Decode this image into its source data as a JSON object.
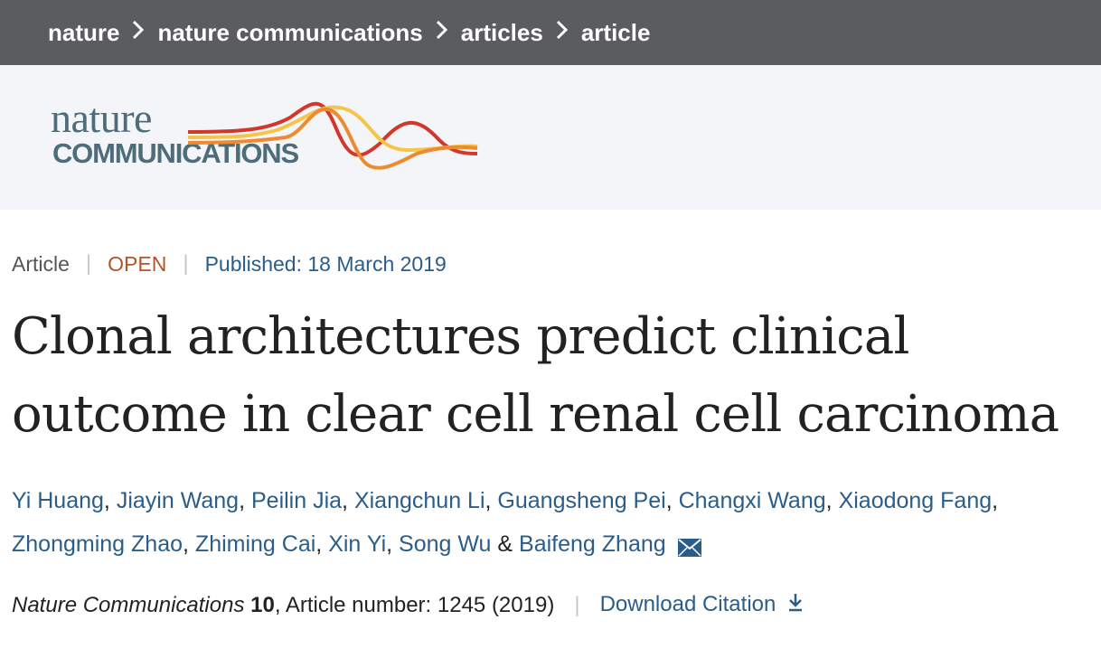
{
  "breadcrumb": {
    "items": [
      "nature",
      "nature communications",
      "articles",
      "article"
    ],
    "separator": ">"
  },
  "logo": {
    "word_top": "nature",
    "word_bottom": "COMMUNICATIONS",
    "colors": {
      "text": "#4e6d7a",
      "wave_red": "#d2372b",
      "wave_orange": "#ee8a2f",
      "wave_yellow": "#f5c54a"
    }
  },
  "meta": {
    "type": "Article",
    "access": "OPEN",
    "published": "Published: 18 March 2019"
  },
  "title": {
    "line1": "Clonal architectures predict clinical",
    "line2": "outcome in clear cell renal cell carcinoma"
  },
  "authors": {
    "list": [
      "Yi Huang",
      "Jiayin Wang",
      "Peilin Jia",
      "Xiangchun Li",
      "Guangsheng Pei",
      "Changxi Wang",
      "Xiaodong Fang",
      "Zhongming Zhao",
      "Zhiming Cai",
      "Xin Yi",
      "Song Wu",
      "Baifeng Zhang"
    ],
    "comma": ",",
    "conjunction": "&",
    "contact_icon": "envelope-icon"
  },
  "citation": {
    "journal": "Nature Communications",
    "volume": "10",
    "details": ", Article number: 1245 (2019)",
    "download_label": "Download Citation",
    "download_icon": "download-arrow-icon"
  },
  "colors": {
    "breadcrumb_bg": "#5b5c60",
    "logo_band_bg": "#f3f5f8",
    "link_blue": "#2a5d8a",
    "open_orange": "#b5532a"
  }
}
